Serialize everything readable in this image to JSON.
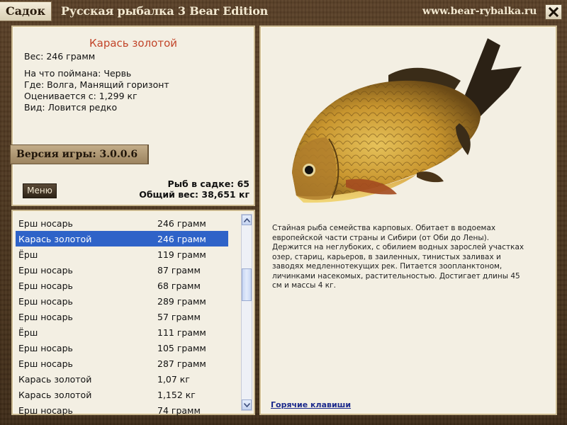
{
  "titlebar": {
    "tab_label": "Садок",
    "app_title": "Русская рыбалка 3 Bear Edition",
    "site": "www.bear-rybalka.ru"
  },
  "fish": {
    "name": "Карась золотой",
    "weight": "Вес: 246 грамм",
    "bait": "На что поймана: Червь",
    "location": "Где: Волга, Манящий горизонт",
    "valued_from": "Оценивается с: 1,299 кг",
    "type": "Вид: Ловится редко"
  },
  "version": "Версия игры: 3.0.0.6",
  "menu_label": "Меню",
  "stats": {
    "fish_count": "Рыб в садке: 65",
    "total_weight": "Общий вес: 38,651 кг"
  },
  "catch_list": [
    {
      "name": "Ерш носарь",
      "weight": "246 грамм"
    },
    {
      "name": "Карась золотой",
      "weight": "246 грамм",
      "selected": true
    },
    {
      "name": "Ёрш",
      "weight": "119 грамм"
    },
    {
      "name": "Ерш носарь",
      "weight": "87 грамм"
    },
    {
      "name": "Ерш носарь",
      "weight": "68 грамм"
    },
    {
      "name": "Ерш носарь",
      "weight": "289 грамм"
    },
    {
      "name": "Ерш носарь",
      "weight": "57 грамм"
    },
    {
      "name": "Ёрш",
      "weight": "111 грамм"
    },
    {
      "name": "Ерш носарь",
      "weight": "105 грамм"
    },
    {
      "name": "Ерш носарь",
      "weight": "287 грамм"
    },
    {
      "name": "Карась золотой",
      "weight": "1,07 кг"
    },
    {
      "name": "Карась золотой",
      "weight": "1,152 кг"
    },
    {
      "name": "Ерш носарь",
      "weight": "74 грамм"
    }
  ],
  "description": "Стайная рыба семейства карповых. Обитает в водоемах европейской части страны и Сибири (от Оби до Лены). Держится на неглубоких, с обилием водных зарослей участках озер, стариц, карьеров, в заиленных, тинистых заливах и заводях медленнотекущих рек. Питается зоопланктоном, личинками насекомых, растительностью. Достигает длины 45 см и массы 4 кг.",
  "hotkeys_label": "Горячие клавиши",
  "colors": {
    "fish_name": "#c2452a",
    "selection": "#2f63c8",
    "link": "#1c2a8c"
  }
}
